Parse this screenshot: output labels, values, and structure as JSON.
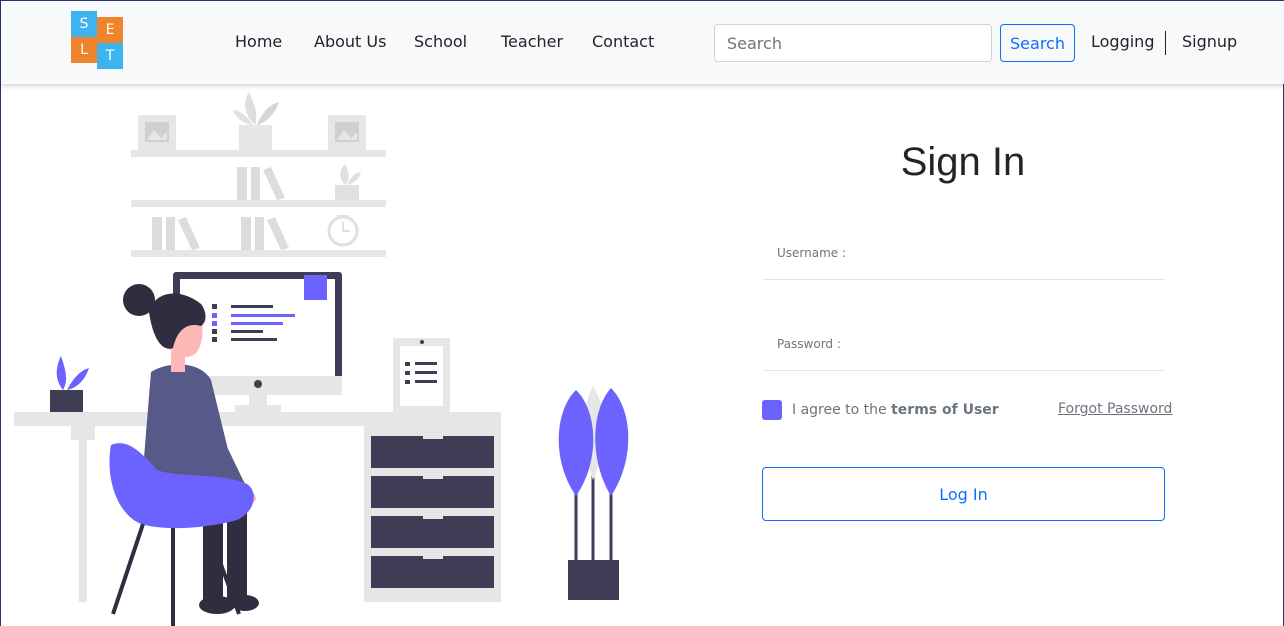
{
  "brand": {
    "logo_letters": [
      "S",
      "E",
      "L",
      "T"
    ],
    "colors": {
      "blue": "#3db4ef",
      "orange": "#f0842c"
    }
  },
  "nav": {
    "links": [
      "Home",
      "About Us",
      "School",
      "Teacher",
      "Contact"
    ],
    "search": {
      "placeholder": "Search",
      "value": ""
    },
    "search_button": "Search",
    "logging": "Logging",
    "signup": "Signup"
  },
  "illustration": {
    "subject": "person at desk with computer",
    "accent": "#6c63ff",
    "dark": "#3f3d56"
  },
  "form": {
    "title": "Sign In",
    "username_label": "Username :",
    "password_label": "Password :",
    "agree_prefix": "I agree to the ",
    "agree_bold": "terms of User",
    "forgot": "Forgot Password",
    "login_button": "Log In",
    "checkbox_checked": true
  },
  "theme": {
    "primary": "#0d6efd",
    "checkbox": "#6c63ff"
  }
}
